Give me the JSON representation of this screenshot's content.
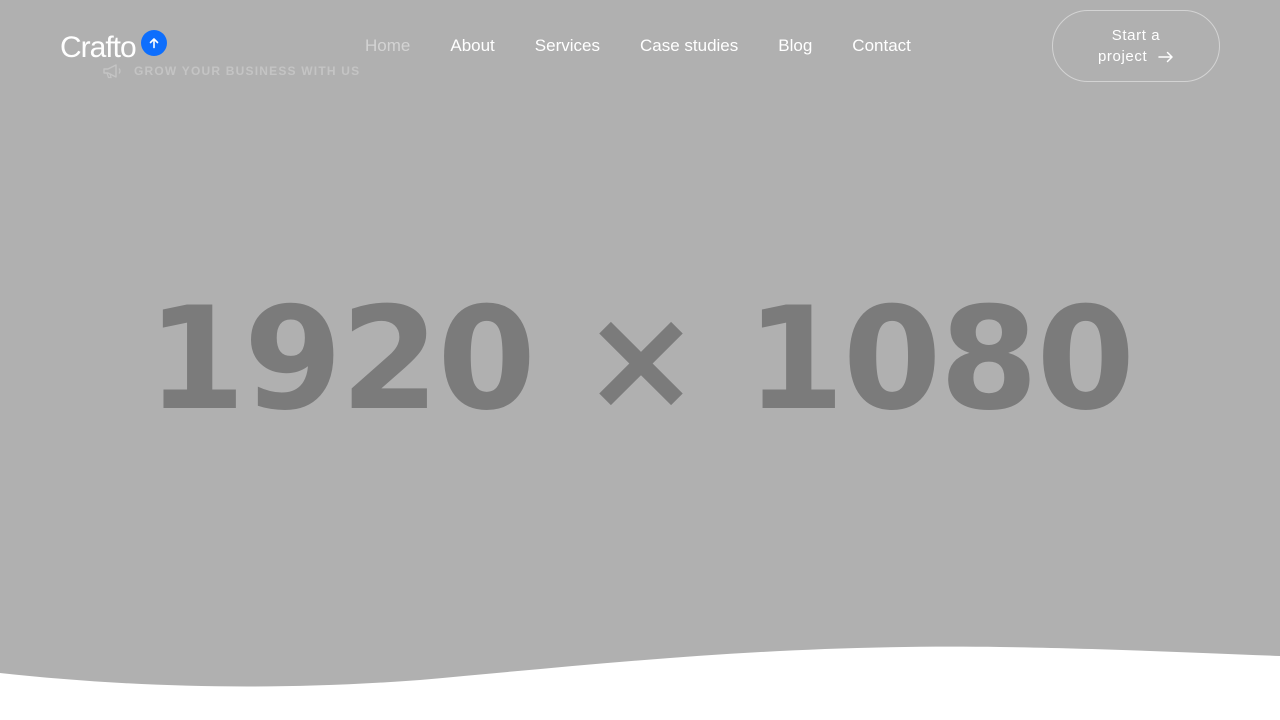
{
  "header": {
    "logo_text": "Crafto",
    "tagline": "GROW YOUR BUSINESS WITH US",
    "nav": [
      {
        "label": "Home",
        "active": true
      },
      {
        "label": "About",
        "active": false
      },
      {
        "label": "Services",
        "active": false
      },
      {
        "label": "Case studies",
        "active": false
      },
      {
        "label": "Blog",
        "active": false
      },
      {
        "label": "Contact",
        "active": false
      }
    ],
    "cta_line1": "Start a",
    "cta_line2": "project"
  },
  "hero": {
    "placeholder_text": "1920 × 1080",
    "background_color": "#b0b0b0",
    "placeholder_color": "#7b7b7b"
  },
  "icons": {
    "scroll_top": "arrow-up-icon",
    "tagline": "megaphone-icon",
    "cta": "arrow-right-icon"
  },
  "colors": {
    "accent": "#0d6efd",
    "nav_text": "#ffffff",
    "nav_active": "#d3d3d3"
  }
}
